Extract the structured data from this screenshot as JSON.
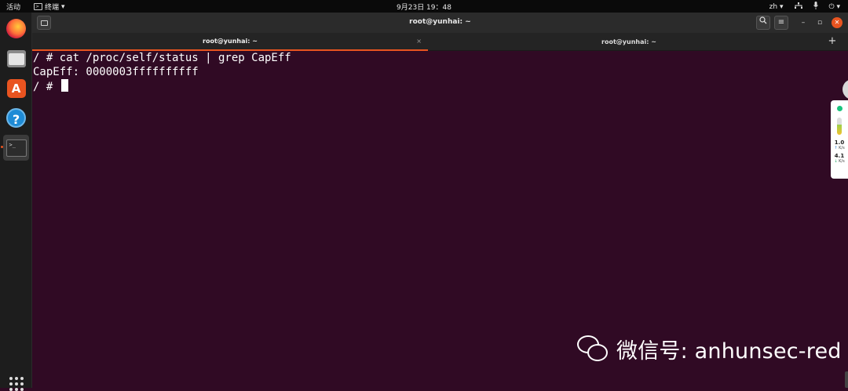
{
  "topbar": {
    "activities": "活动",
    "app_menu_label": "终端",
    "clock": "9月23日 19：48",
    "input_method": "zh"
  },
  "headerbar": {
    "title": "root@yunhai: ~"
  },
  "tabs": [
    {
      "label": "root@yunhai: ~",
      "active": true
    },
    {
      "label": "root@yunhai: ~",
      "active": false
    }
  ],
  "terminal": {
    "lines": [
      "/ # cat /proc/self/status | grep CapEff",
      "CapEff: 0000003ffffffffff",
      "/ # "
    ]
  },
  "side_widget": {
    "upload_value": "1.0",
    "upload_unit": "K/s",
    "download_value": "4.1",
    "download_unit": "K/s"
  },
  "watermark": {
    "text": "微信号: anhunsec-red"
  },
  "colors": {
    "terminal_bg": "#300a24",
    "accent": "#e95420",
    "panel": "#0a0a0a"
  },
  "icons": {
    "dock": [
      "firefox-icon",
      "files-icon",
      "software-store-icon",
      "help-icon",
      "terminal-icon",
      "show-apps-icon"
    ],
    "tray": [
      "network-icon",
      "volume-icon",
      "power-icon"
    ]
  }
}
